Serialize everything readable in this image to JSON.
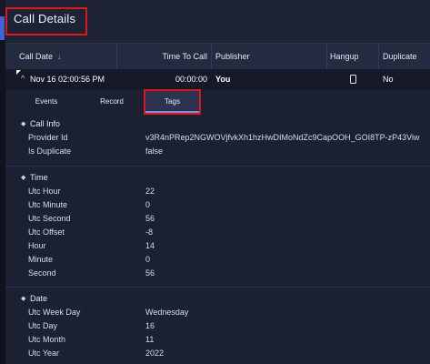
{
  "panel": {
    "title": "Call Details"
  },
  "table": {
    "headers": {
      "call_date": "Call Date",
      "time_to_call": "Time To Call",
      "publisher": "Publisher",
      "hangup": "Hangup",
      "duplicate": "Duplicate"
    },
    "row": {
      "call_date": "Nov 16 02:00:56 PM",
      "time_to_call": "00:00:00",
      "publisher": "You",
      "hangup_icon": "phone-icon",
      "duplicate": "No"
    }
  },
  "tabs": [
    {
      "label": "Events"
    },
    {
      "label": "Record"
    },
    {
      "label": "Tags",
      "active": true
    }
  ],
  "sections": {
    "call_info": {
      "title": "Call Info",
      "rows": [
        {
          "key": "Provider Id",
          "value": "v3R4nPRep2NGWOVjfvkXh1hzHwDIMoNdZc9CapOOH_GOI8TP-zP43Viw"
        },
        {
          "key": "Is Duplicate",
          "value": "false"
        }
      ]
    },
    "time": {
      "title": "Time",
      "rows": [
        {
          "key": "Utc Hour",
          "value": "22"
        },
        {
          "key": "Utc Minute",
          "value": "0"
        },
        {
          "key": "Utc Second",
          "value": "56"
        },
        {
          "key": "Utc Offset",
          "value": "-8"
        },
        {
          "key": "Hour",
          "value": "14"
        },
        {
          "key": "Minute",
          "value": "0"
        },
        {
          "key": "Second",
          "value": "56"
        }
      ]
    },
    "date": {
      "title": "Date",
      "rows": [
        {
          "key": "Utc Week Day",
          "value": "Wednesday"
        },
        {
          "key": "Utc Day",
          "value": "16"
        },
        {
          "key": "Utc Month",
          "value": "11"
        },
        {
          "key": "Utc Year",
          "value": "2022"
        }
      ]
    }
  },
  "colors": {
    "background": "#141827",
    "panel": "#1b2033",
    "highlight_border": "#e01515",
    "accent": "#3d63d6"
  }
}
